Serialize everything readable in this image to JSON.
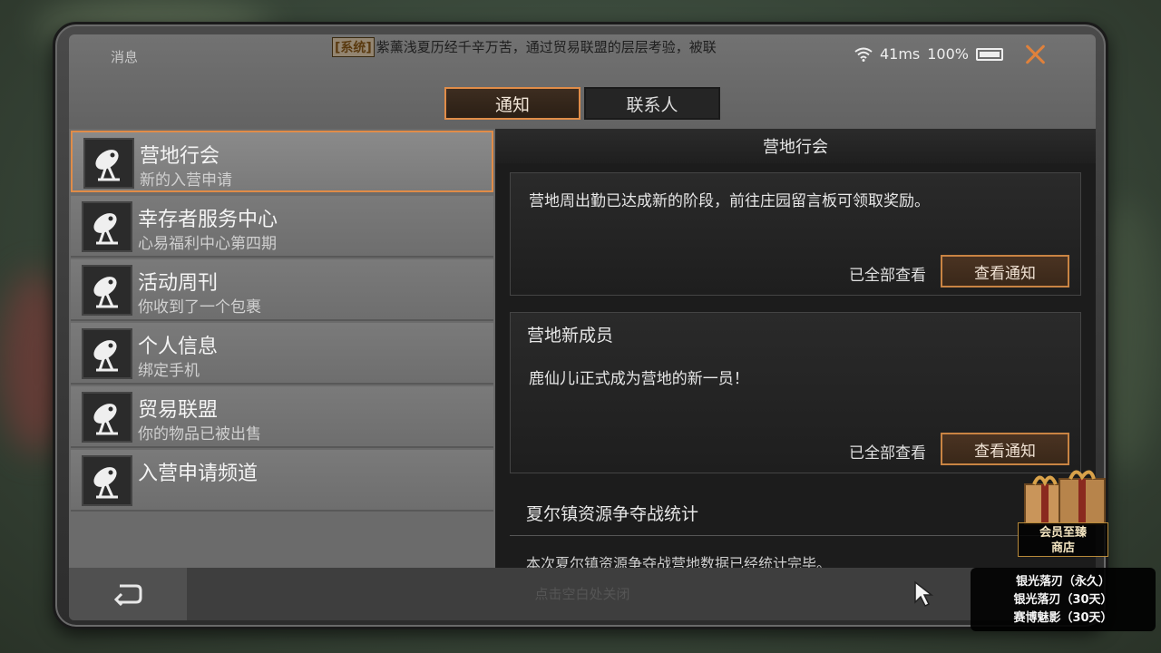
{
  "status": {
    "title": "消息",
    "ticker_tag": "[系统]",
    "ticker_text": "紫薰浅夏历经千辛万苦，通过贸易联盟的层层考验，被联",
    "latency": "41ms",
    "battery": "100%"
  },
  "tabs": [
    {
      "label": "通知",
      "active": true
    },
    {
      "label": "联系人",
      "active": false
    }
  ],
  "list": [
    {
      "name": "营地行会",
      "sub": "新的入营申请",
      "icon": "radar-dish-icon"
    },
    {
      "name": "幸存者服务中心",
      "sub": "心易福利中心第四期",
      "icon": "radar-dish-icon"
    },
    {
      "name": "活动周刊",
      "sub": "你收到了一个包裹",
      "icon": "radar-dish-icon"
    },
    {
      "name": "个人信息",
      "sub": "绑定手机",
      "icon": "radar-dish-icon"
    },
    {
      "name": "贸易联盟",
      "sub": "你的物品已被出售",
      "icon": "radar-dish-icon"
    },
    {
      "name": "入营申请频道",
      "sub": "",
      "icon": "radar-dish-icon"
    }
  ],
  "panel": {
    "header": "营地行会",
    "card1": {
      "text": "营地周出勤已达成新的阶段，前往庄园留言板可领取奖励。",
      "seen": "已全部查看",
      "button": "查看通知"
    },
    "card2": {
      "title": "营地新成员",
      "text": "鹿仙儿i正式成为营地的新一员！",
      "seen": "已全部查看",
      "button": "查看通知"
    },
    "section3": {
      "title": "夏尔镇资源争夺战统计",
      "text": "本次夏尔镇资源争夺战营地数据已经统计完毕。"
    }
  },
  "bottom": {
    "hint": "点击空白处关闭"
  },
  "shop": {
    "line1": "会员至臻",
    "line2": "商店"
  },
  "promo": [
    "银光落刃（永久）",
    "银光落刃（30天）",
    "赛博魅影（30天）"
  ],
  "colors": {
    "accent": "#e08c48",
    "close": "#e0813b"
  }
}
